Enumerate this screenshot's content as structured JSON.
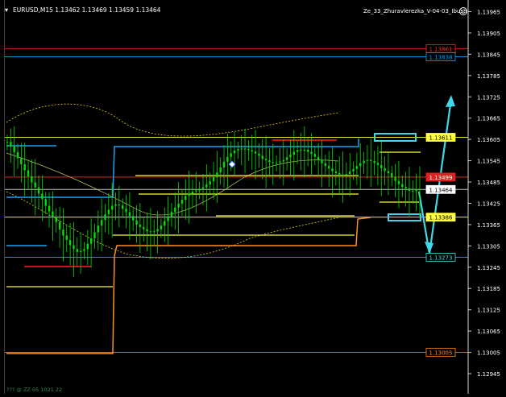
{
  "header": {
    "symbol_info": "EURUSD,M15  1.13462 1.13469 1.13459 1.13464",
    "indicator_name": "Ze_33_Zhuravlerezka_V-04-03_Ibush",
    "footer_text": "??? @ ZZ 05 1021 22"
  },
  "chart_data": {
    "type": "candlestick",
    "symbol": "EURUSD",
    "timeframe": "M15",
    "ohlc_header": {
      "open": 1.13462,
      "high": 1.13469,
      "low": 1.13459,
      "close": 1.13464
    },
    "ylim": [
      1.1293,
      1.1397
    ],
    "y_ticks": [
      "1.13965",
      "1.13905",
      "1.13845",
      "1.13785",
      "1.13725",
      "1.13665",
      "1.13605",
      "1.13545",
      "1.13485",
      "1.13425",
      "1.13365",
      "1.13305",
      "1.13245",
      "1.13185",
      "1.13125",
      "1.13065",
      "1.13005",
      "1.12945"
    ],
    "price_labels": [
      {
        "text": "1.13861",
        "value": 1.13861,
        "color": "#ff2a2a",
        "bg": "#000000"
      },
      {
        "text": "1.13838",
        "value": 1.13838,
        "color": "#1ea0e6",
        "bg": "#000000"
      },
      {
        "text": "1.13611",
        "value": 1.13611,
        "color": "#000000",
        "bg": "#ffff40"
      },
      {
        "text": "1.13499",
        "value": 1.13499,
        "color": "#ffffff",
        "bg": "#e02020"
      },
      {
        "text": "1.13464",
        "value": 1.13464,
        "color": "#000000",
        "bg": "#ffffff"
      },
      {
        "text": "1.13386",
        "value": 1.13386,
        "color": "#000000",
        "bg": "#ffff40"
      },
      {
        "text": "1.13273",
        "value": 1.13273,
        "color": "#40e0e8",
        "bg": "#000000"
      },
      {
        "text": "1.13005",
        "value": 1.13005,
        "color": "#ff8c1a",
        "bg": "#000000"
      }
    ],
    "horizontal_lines": [
      {
        "value": 1.13861,
        "color": "#d02020"
      },
      {
        "value": 1.13838,
        "color": "#1a90d0"
      },
      {
        "value": 1.13611,
        "color": "#e8e820"
      },
      {
        "value": 1.13499,
        "color": "#d03020"
      },
      {
        "value": 1.13464,
        "color": "#c0c0c0"
      },
      {
        "value": 1.13386,
        "color": "#e8e820"
      },
      {
        "value": 1.13273,
        "color": "#1a90d0"
      },
      {
        "value": 1.13005,
        "color": "#d07010"
      }
    ],
    "colors": {
      "background": "#000000",
      "candles": "#00e000",
      "yellow": "#ffff40",
      "orange": "#ff9020",
      "blue": "#20a0f0",
      "cyan": "#40d8e8",
      "red": "#ff2020",
      "envelope": "#e8d020"
    },
    "series": {
      "close": [
        1.13598,
        1.13585,
        1.13569,
        1.13552,
        1.13535,
        1.13518,
        1.13501,
        1.13484,
        1.1347,
        1.13452,
        1.13437,
        1.13418,
        1.13402,
        1.13387,
        1.13372,
        1.13351,
        1.13334,
        1.13322,
        1.13307,
        1.13296,
        1.13288,
        1.13291,
        1.13296,
        1.13311,
        1.13326,
        1.13343,
        1.13362,
        1.13378,
        1.13394,
        1.13407,
        1.13418,
        1.13422,
        1.13419,
        1.1341,
        1.134,
        1.13389,
        1.13377,
        1.13365,
        1.13358,
        1.13352,
        1.13346,
        1.13345,
        1.13346,
        1.13352,
        1.13362,
        1.13375,
        1.13388,
        1.13401,
        1.13413,
        1.13424,
        1.13435,
        1.13446,
        1.13452,
        1.13458,
        1.13461,
        1.13466,
        1.1347,
        1.13478,
        1.13487,
        1.13499,
        1.13512,
        1.13526,
        1.13542,
        1.13556,
        1.13566,
        1.13574,
        1.13578,
        1.13579,
        1.13578,
        1.13575,
        1.13571,
        1.13565,
        1.13559,
        1.1355,
        1.13546,
        1.13541,
        1.13539,
        1.1354,
        1.13543,
        1.13547,
        1.13555,
        1.13562,
        1.1357,
        1.13575,
        1.13576,
        1.13576,
        1.1357,
        1.13564,
        1.13556,
        1.13547,
        1.13538,
        1.1353,
        1.13523,
        1.13515,
        1.1351,
        1.13506,
        1.13505,
        1.13507,
        1.13515,
        1.13522,
        1.1353,
        1.13538,
        1.13545,
        1.13547,
        1.13544,
        1.13539,
        1.13533,
        1.13524,
        1.13516,
        1.1351,
        1.13498,
        1.13488,
        1.13479,
        1.13471,
        1.13467,
        1.1346,
        1.13459,
        1.13462,
        1.13464
      ],
      "red_short_segments": [
        {
          "x_from": 30,
          "x_to": 113,
          "value": 1.13243
        },
        {
          "x_from": 338,
          "x_to": 418,
          "value": 1.13609
        },
        {
          "x_from": 0,
          "x_to": 529,
          "value": 1.13499
        }
      ]
    },
    "forecast_arrow": {
      "from": 1.13464,
      "to_low": 1.13273,
      "to_high": 1.13743
    }
  }
}
